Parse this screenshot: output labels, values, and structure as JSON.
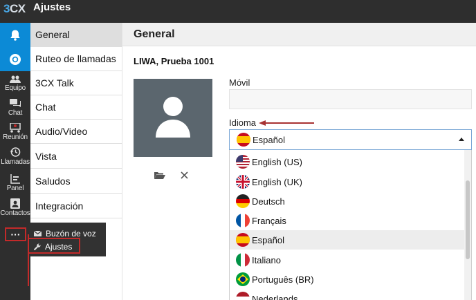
{
  "app": {
    "logo": "3CX",
    "title": "Ajustes"
  },
  "leftnav": {
    "items": [
      {
        "label": "",
        "icon": "bell-icon"
      },
      {
        "label": "",
        "icon": "chrome-icon"
      },
      {
        "label": "Equipo",
        "icon": "team-icon"
      },
      {
        "label": "Chat",
        "icon": "chat-icon"
      },
      {
        "label": "Reunión",
        "icon": "meeting-icon"
      },
      {
        "label": "Llamadas",
        "icon": "history-icon"
      },
      {
        "label": "Panel",
        "icon": "panel-icon"
      },
      {
        "label": "Contactos",
        "icon": "contacts-icon"
      }
    ],
    "more": "···"
  },
  "submenu": {
    "items": [
      "General",
      "Ruteo de llamadas",
      "3CX Talk",
      "Chat",
      "Audio/Video",
      "Vista",
      "Saludos",
      "Integración"
    ]
  },
  "popup": {
    "items": [
      {
        "label": "Buzón de voz",
        "icon": "envelope-icon"
      },
      {
        "label": "Ajustes",
        "icon": "wrench-icon"
      }
    ]
  },
  "main": {
    "title": "General",
    "user_name": "LIWA, Prueba  1001",
    "movil_label": "Móvil",
    "movil_value": "",
    "idioma_label": "Idioma",
    "selected_language": "Español",
    "languages": [
      "English (US)",
      "English (UK)",
      "Deutsch",
      "Français",
      "Español",
      "Italiano",
      "Português (BR)",
      "Nederlands"
    ],
    "highlighted_language": "Español"
  },
  "colors": {
    "accent": "#0c8ad6",
    "annotation": "#c32a2a",
    "dark": "#2e2e2e"
  }
}
